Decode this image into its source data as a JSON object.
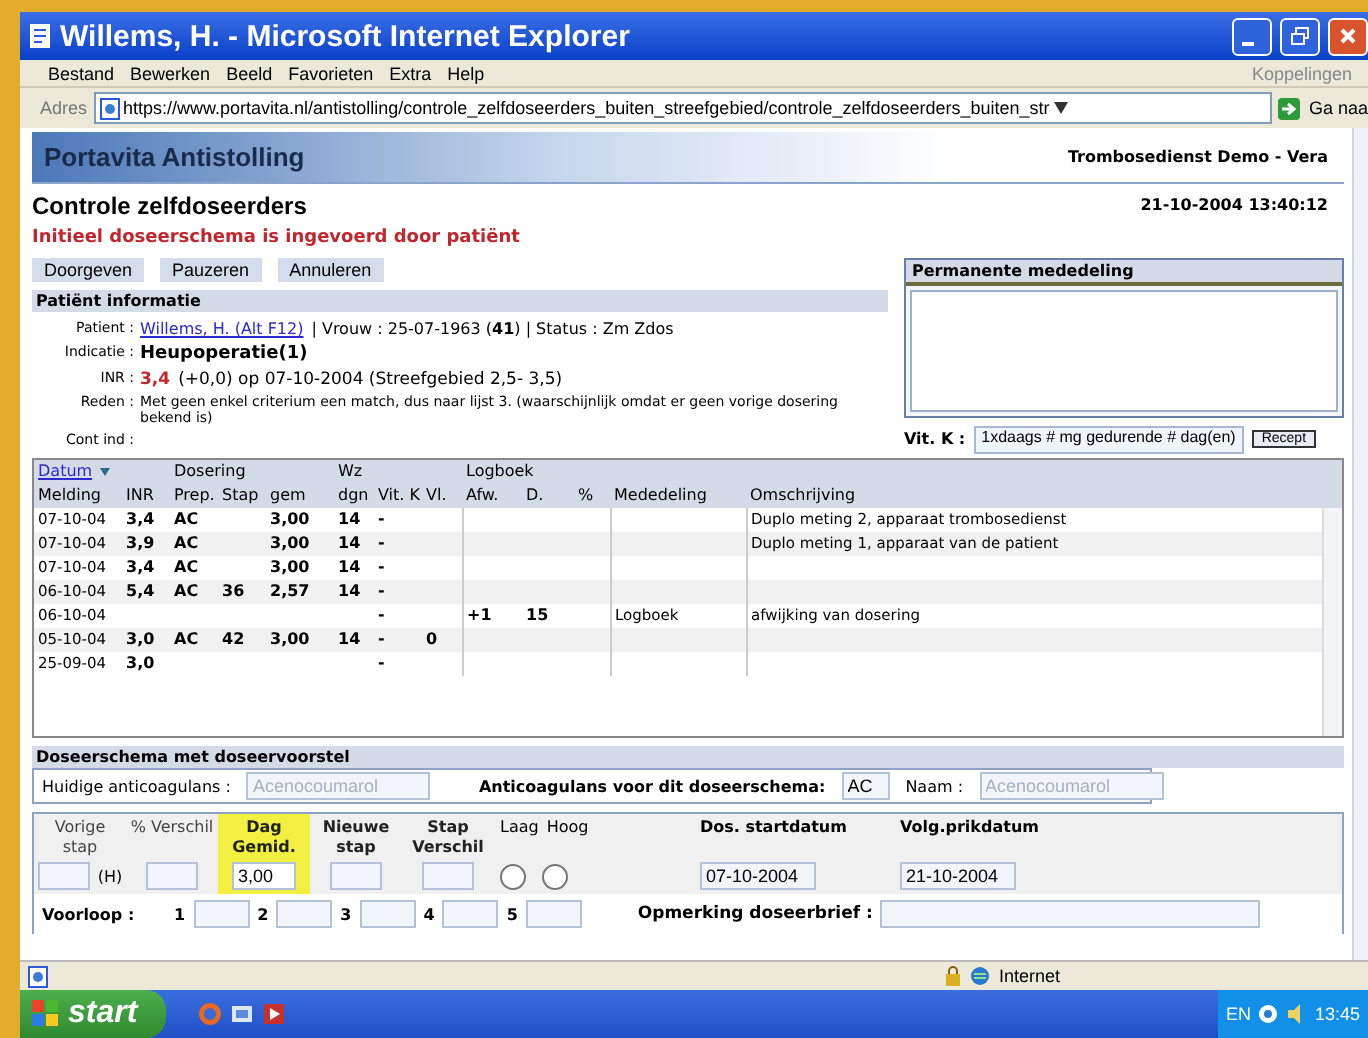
{
  "window": {
    "title": "Willems, H. - Microsoft Internet Explorer"
  },
  "menu": [
    "Bestand",
    "Bewerken",
    "Beeld",
    "Favorieten",
    "Extra",
    "Help"
  ],
  "links_label": "Koppelingen",
  "address": {
    "label": "Adres",
    "url": "https://www.portavita.nl/antistolling/controle_zelfdoseerders_buiten_streefgebied/controle_zelfdoseerders_buiten_str",
    "go": "Ga naa"
  },
  "app_header": {
    "title": "Portavita Antistolling",
    "user": "Trombosedienst Demo - Vera"
  },
  "page": {
    "title": "Controle zelfdoseerders",
    "datetime": "21-10-2004 13:40:12",
    "notice": "Initieel doseerschema is ingevoerd door patiënt"
  },
  "actions": [
    "Doorgeven",
    "Pauzeren",
    "Annuleren"
  ],
  "permanent_message": {
    "title": "Permanente mededeling"
  },
  "patient_info": {
    "title": "Patiënt informatie",
    "rows": [
      {
        "kind": "patient",
        "label": "Patient :",
        "link": "Willems, H. (Alt F12)",
        "value": "| Vrouw : 25-07-1963 (**41**) | Status : Zm Zdos"
      },
      {
        "kind": "indication",
        "label": "Indicatie :",
        "value": "Heupoperatie(1)"
      },
      {
        "kind": "inr",
        "label": "INR :",
        "highlight": "3,4",
        "value": "(+0,0) op 07-10-2004 (Streefgebied 2,5- 3,5)"
      },
      {
        "kind": "text",
        "label": "Reden :",
        "value": "Met geen enkel criterium een match, dus naar lijst 3. (waarschijnlijk omdat er geen vorige dosering bekend is)"
      },
      {
        "kind": "text",
        "label": "Cont ind :"
      }
    ]
  },
  "vitamin_k": {
    "label": "Vit. K :",
    "value": "1xdaags # mg gedurende # dag(en)",
    "button": "Recept"
  },
  "table": {
    "columns": [
      {
        "label": "Melding",
        "group": "Datum",
        "sortable": true
      },
      {
        "label": "INR"
      },
      {
        "label": "Prep.",
        "group": "Dosering"
      },
      {
        "label": "Stap"
      },
      {
        "label": "gem"
      },
      {
        "label": "dgn",
        "group": "Wz"
      },
      {
        "label": "Vit. K"
      },
      {
        "label": "Vl."
      },
      {
        "label": "Afw.",
        "group": "Logboek"
      },
      {
        "label": "D."
      },
      {
        "label": "%"
      },
      {
        "label": "Mededeling"
      },
      {
        "label": "Omschrijving"
      }
    ],
    "rows": [
      [
        "07-10-04",
        "3,4",
        "AC",
        null,
        "3,00",
        "14",
        "-",
        null,
        null,
        null,
        null,
        null,
        "Duplo meting 2, apparaat trombosedienst"
      ],
      [
        "07-10-04",
        "3,9",
        "AC",
        null,
        "3,00",
        "14",
        "-",
        null,
        null,
        null,
        null,
        null,
        "Duplo meting 1, apparaat van de patient"
      ],
      [
        "07-10-04",
        "3,4",
        "AC",
        null,
        "3,00",
        "14",
        "-",
        null,
        null,
        null,
        null,
        null,
        null
      ],
      [
        "06-10-04",
        "5,4",
        "AC",
        "36",
        "2,57",
        "14",
        "-",
        null,
        null,
        null,
        null,
        null,
        null
      ],
      [
        "06-10-04",
        null,
        null,
        null,
        null,
        null,
        "-",
        null,
        "+1",
        "15",
        null,
        "Logboek",
        "afwijking van dosering"
      ],
      [
        "05-10-04",
        "3,0",
        "AC",
        "42",
        "3,00",
        "14",
        "-",
        "0",
        null,
        null,
        null,
        null,
        null
      ],
      [
        "25-09-04",
        "3,0",
        null,
        null,
        null,
        null,
        "-",
        null,
        null,
        null,
        null,
        null,
        null
      ]
    ]
  },
  "schedule": {
    "title": "Doseerschema met doseervoorstel",
    "current": {
      "label": "Huidige anticoagulans :",
      "value": "Acenocoumarol",
      "disabled": true
    },
    "scheme": {
      "label": "Anticoagulans voor dit doseerschema:",
      "value": "AC",
      "disabled": false
    },
    "name": {
      "label": "Naam :",
      "value": "Acenocoumarol",
      "disabled": true
    },
    "dosage": [
      {
        "kind": "input",
        "label": "Vorige stap",
        "suffix": "(H)",
        "emphasized": false,
        "highlighted": false
      },
      {
        "kind": "input",
        "label": "% Verschil",
        "emphasized": false,
        "highlighted": false
      },
      {
        "kind": "input",
        "label": "Dag Gemid.",
        "value": "3,00",
        "emphasized": true,
        "highlighted": true
      },
      {
        "kind": "input",
        "label": "Nieuwe stap",
        "emphasized": true,
        "highlighted": false
      },
      {
        "kind": "input",
        "label": "Stap Verschil",
        "emphasized": true,
        "highlighted": false
      },
      {
        "kind": "radios",
        "options": [
          {
            "label": "Laag",
            "checked": false
          },
          {
            "label": "Hoog",
            "checked": false
          }
        ]
      },
      {
        "kind": "date",
        "label": "Dos. startdatum",
        "value": "07-10-2004"
      },
      {
        "kind": "date",
        "label": "Volg.prikdatum",
        "value": "21-10-2004"
      }
    ],
    "preliminary": {
      "label": "Voorloop :",
      "fields": [
        "1",
        "2",
        "3",
        "4",
        "5"
      ]
    },
    "remark": {
      "label": "Opmerking  doseerbrief :"
    }
  },
  "status_bar": {
    "zone": "Internet"
  },
  "taskbar": {
    "start": "start",
    "language": "EN",
    "clock": "13:45"
  }
}
